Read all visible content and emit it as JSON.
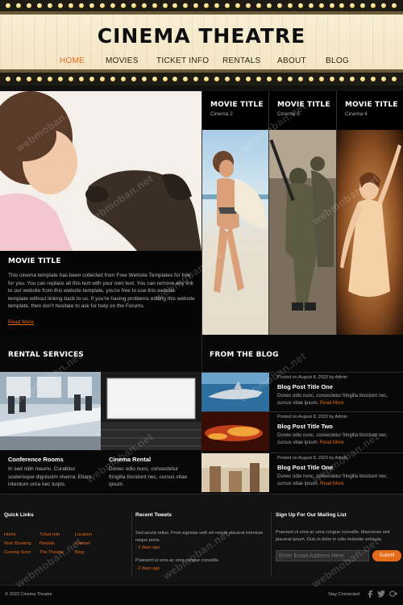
{
  "header": {
    "site_title": "CINEMA THEATRE",
    "nav": [
      {
        "label": "HOME",
        "active": true
      },
      {
        "label": "MOVIES",
        "active": false
      },
      {
        "label": "TICKET INFO",
        "active": false
      },
      {
        "label": "RENTALS",
        "active": false
      },
      {
        "label": "ABOUT",
        "active": false
      },
      {
        "label": "BLOG",
        "active": false
      }
    ]
  },
  "feature": {
    "title": "MOVIE TITLE",
    "body": "This cinema template has been collected from Free Website Templates for free for you. You can replace all this text with your own text. You can remove any link to our website from this website template, you're free to use this website template without linking back to us. If you're having problems editing this website template, then don't hesitate to ask for help on the Forums.",
    "read_more": "Read More"
  },
  "movies": [
    {
      "title": "MOVIE TITLE",
      "subtitle": "Cinema 2"
    },
    {
      "title": "MOVIE TITLE",
      "subtitle": "Cinema 3"
    },
    {
      "title": "MOVIE TITLE",
      "subtitle": "Cinema 4"
    }
  ],
  "rentals": {
    "heading": "RENTAL SERVICES",
    "items": [
      {
        "title": "Conference Rooms",
        "body": "In sed nibh mauris. Curabitur scelerisque dignissim viverra. Etiam interdum urna nec turpis."
      },
      {
        "title": "Cinema Rental",
        "body": "Donec odio nunc, consectetur fringilla tincidunt nec, cursus vitae ipsum."
      }
    ]
  },
  "blog": {
    "heading": "FROM THE BLOG",
    "posts": [
      {
        "meta": "Posted on August 8, 2023 by Admin",
        "title": "Blog Post Title One",
        "excerpt": "Donec odio nunc, consectetur fringilla tincidunt nec, cursus vitae ipsum.",
        "more": "Read More"
      },
      {
        "meta": "Posted on August 8, 2023 by Admin",
        "title": "Blog Post Title Two",
        "excerpt": "Donec odio nunc, consectetur fringilla tincidunt nec, cursus vitae ipsum.",
        "more": "Read More"
      },
      {
        "meta": "Posted on August 8, 2023 by Admin",
        "title": "Blog Post Title One",
        "excerpt": "Donec odio nunc, consectetur fringilla tincidunt nec, cursus vitae ipsum.",
        "more": "Read More"
      }
    ]
  },
  "footer": {
    "quick_links": {
      "title": "Quick Links",
      "col1": [
        "Home",
        "Now Showing",
        "Coming Soon"
      ],
      "col2": [
        "Ticket Info",
        "Rentals",
        "The Theatre"
      ],
      "col3": [
        "Location",
        "Contact",
        "Blog"
      ]
    },
    "tweets": {
      "title": "Recent Tweets",
      "items": [
        {
          "text": "Sed iaculis tellus. Proin egestas velit vel neque placerat interdum neque porta.",
          "date": "- 2 days ago"
        },
        {
          "text": "Praesent ut urna ac urna congue convallis.",
          "date": "- 2 days ago"
        }
      ]
    },
    "mailing": {
      "title": "Sign Up For Our Mailing List",
      "text": "Praesent ut urna ac urna congue convallis. Maecenas sed placerat ipsum. Duis in dolor in odio molestie vehicula.",
      "placeholder": "Enter Email Address Here",
      "submit": "Submit"
    },
    "copyright": "© 2023 Cinema Theatre",
    "stay_connected": "Stay Connected",
    "social": [
      "facebook-icon",
      "twitter-icon",
      "googleplus-icon"
    ]
  },
  "watermark": "webmoban.net",
  "colors": {
    "accent": "#e66a18",
    "marquee": "#f2e3bf",
    "background": "#000000"
  }
}
